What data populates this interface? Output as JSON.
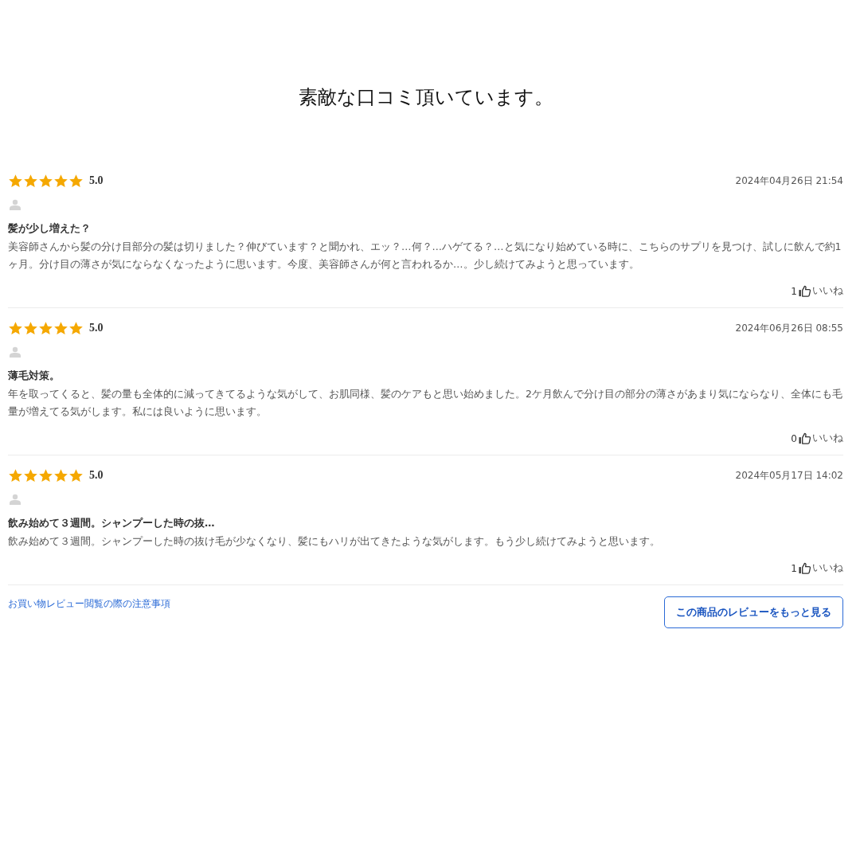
{
  "heading": "素敵な口コミ頂いています。",
  "reviews": [
    {
      "stars": 5,
      "rating": "5.0",
      "date": "2024年04月26日 21:54",
      "title": "髪が少し増えた？",
      "body": "美容師さんから髪の分け目部分の髪は切りました？伸びています？と聞かれ、エッ？…何？…ハゲてる？…と気になり始めている時に、こちらのサプリを見つけ、試しに飲んで約1ヶ月。分け目の薄さが気にならなくなったように思います。今度、美容師さんが何と言われるか…。少し続けてみようと思っています。",
      "likes": "1",
      "like_label": "いいね"
    },
    {
      "stars": 5,
      "rating": "5.0",
      "date": "2024年06月26日 08:55",
      "title": "薄毛対策。",
      "body": "年を取ってくると、髪の量も全体的に減ってきてるような気がして、お肌同様、髪のケアもと思い始めました。2ケ月飲んで分け目の部分の薄さがあまり気にならなり、全体にも毛量が増えてる気がします。私には良いように思います。",
      "likes": "0",
      "like_label": "いいね"
    },
    {
      "stars": 5,
      "rating": "5.0",
      "date": "2024年05月17日 14:02",
      "title": "飲み始めて３週間。シャンプーした時の抜…",
      "body": "飲み始めて３週間。シャンプーした時の抜け毛が少なくなり、髪にもハリが出てきたような気がします。もう少し続けてみようと思います。",
      "likes": "1",
      "like_label": "いいね"
    }
  ],
  "footer": {
    "notice_link": "お買い物レビュー閲覧の際の注意事項",
    "more_button": "この商品のレビューをもっと見る"
  }
}
